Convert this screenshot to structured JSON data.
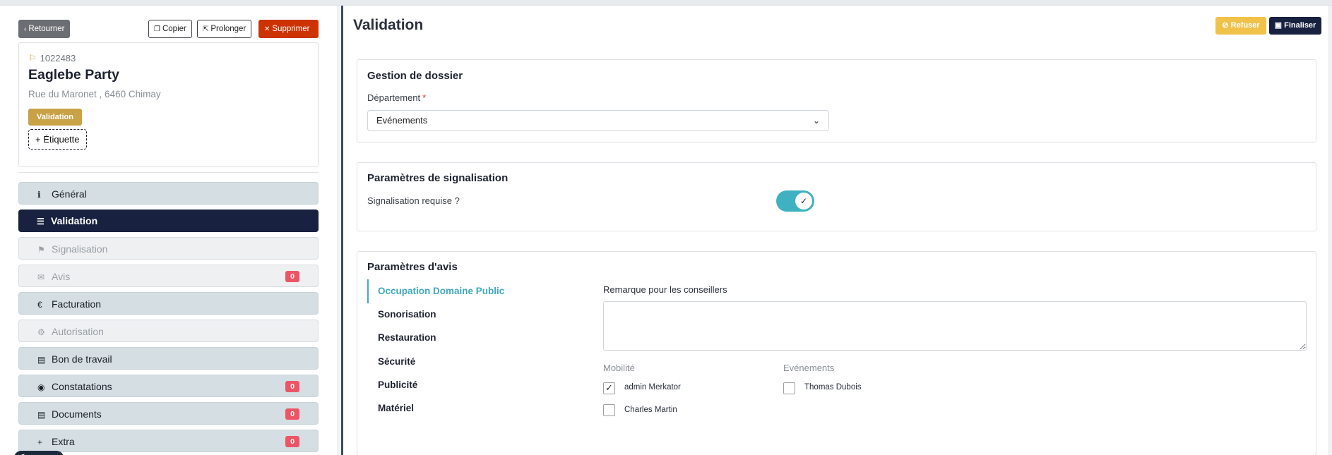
{
  "top": {
    "back_label": "Retourner",
    "copy_label": "Copier",
    "extend_label": "Prolonger",
    "delete_label": "Supprimer"
  },
  "record": {
    "id": "1022483",
    "name": "Eaglebe Party",
    "address": "Rue du Maronet , 6460 Chimay",
    "status": "Validation",
    "add_tag_label": "+ Étiquette"
  },
  "nav": {
    "items": [
      {
        "label": "Général",
        "icon": "info-icon",
        "state": "normal"
      },
      {
        "label": "Validation",
        "icon": "checklist-icon",
        "state": "active"
      },
      {
        "label": "Signalisation",
        "icon": "signpost-icon",
        "state": "disabled"
      },
      {
        "label": "Avis",
        "icon": "comment-icon",
        "state": "disabled",
        "badge": "0"
      },
      {
        "label": "Facturation",
        "icon": "euro-icon",
        "state": "normal"
      },
      {
        "label": "Autorisation",
        "icon": "file-gear-icon",
        "state": "disabled"
      },
      {
        "label": "Bon de travail",
        "icon": "file-icon",
        "state": "normal"
      },
      {
        "label": "Constatations",
        "icon": "eye-icon",
        "state": "normal",
        "badge": "0"
      },
      {
        "label": "Documents",
        "icon": "document-icon",
        "state": "normal",
        "badge": "0"
      },
      {
        "label": "Extra",
        "icon": "plus-icon",
        "state": "normal",
        "badge": "0"
      }
    ]
  },
  "main": {
    "title": "Validation",
    "refuse_label": "Refuser",
    "finalize_label": "Finaliser"
  },
  "dossier": {
    "title": "Gestion de dossier",
    "department_label": "Département",
    "department_value": "Evénements"
  },
  "signal": {
    "title": "Paramètres de signalisation",
    "question": "Signalisation requise ?",
    "enabled": true
  },
  "avis": {
    "title": "Paramètres d'avis",
    "tabs": [
      "Occupation Domaine Public",
      "Sonorisation",
      "Restauration",
      "Sécurité",
      "Publicité",
      "Matériel"
    ],
    "active_tab": "Occupation Domaine Public",
    "remark_label": "Remarque pour les conseillers",
    "groups": [
      {
        "label": "Mobilité",
        "members": [
          {
            "name": "admin Merkator",
            "checked": true
          },
          {
            "name": "Charles Martin",
            "checked": false
          }
        ]
      },
      {
        "label": "Evénements",
        "members": [
          {
            "name": "Thomas Dubois",
            "checked": false
          }
        ]
      }
    ]
  },
  "colors": {
    "active_nav": "#182140",
    "accent": "#3fb1c0",
    "status_badge": "#c9a247",
    "delete": "#cc3300",
    "refuse": "#f0c24a",
    "count_badge": "#ed5565"
  }
}
